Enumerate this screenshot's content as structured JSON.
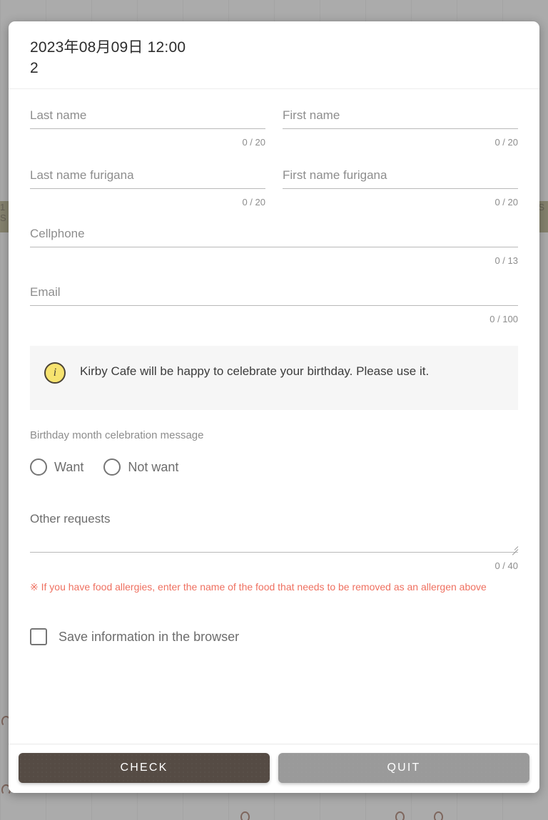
{
  "modal": {
    "title": "2023年08月09日 12:00\n2"
  },
  "fields": {
    "last_name": {
      "label": "Last name",
      "value": "",
      "counter": "0 / 20"
    },
    "first_name": {
      "label": "First name",
      "value": "",
      "counter": "0 / 20"
    },
    "last_name_furigana": {
      "label": "Last name furigana",
      "value": "",
      "counter": "0 / 20"
    },
    "first_name_furigana": {
      "label": "First name furigana",
      "value": "",
      "counter": "0 / 20"
    },
    "cellphone": {
      "label": "Cellphone",
      "value": "",
      "counter": "0 / 13"
    },
    "email": {
      "label": "Email",
      "value": "",
      "counter": "0 / 100"
    },
    "other_requests": {
      "label": "Other requests",
      "value": "",
      "counter": "0 / 40"
    }
  },
  "info_banner": {
    "icon": "info-icon",
    "text": "Kirby Cafe will be happy to celebrate your birthday. Please use it."
  },
  "birthday_group": {
    "label": "Birthday month celebration message",
    "options": [
      {
        "label": "Want",
        "selected": false
      },
      {
        "label": "Not want",
        "selected": false
      }
    ]
  },
  "allergy_warning": "※ If you have food allergies, enter the name of the food that needs to be removed as an allergen above",
  "save_checkbox": {
    "label": "Save information in the browser",
    "checked": false
  },
  "footer": {
    "check_label": "CHECK",
    "quit_label": "QUIT"
  },
  "background": {
    "left_chip": "1\nS",
    "right_chip": "(S"
  },
  "colors": {
    "check_button": "#554b44",
    "quit_button": "#9a9a9a",
    "info_icon": "#f7e36f",
    "warning_text": "#ef7060",
    "scrim": "#787878"
  }
}
